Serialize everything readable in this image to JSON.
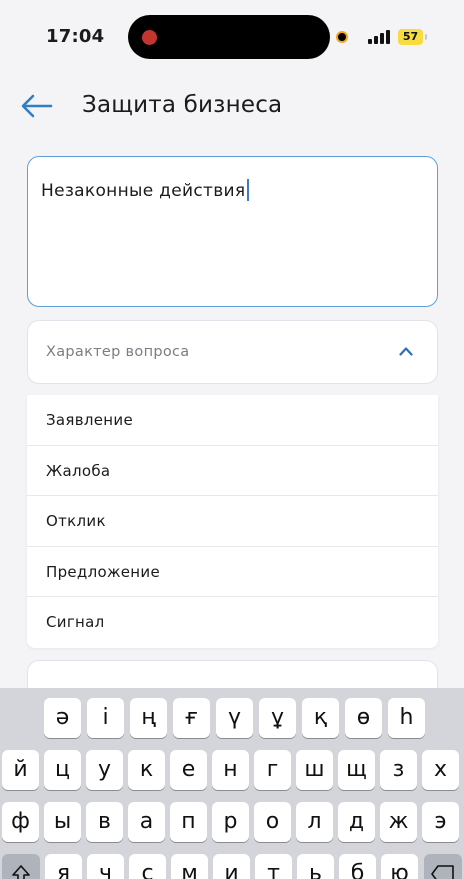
{
  "status_bar": {
    "time": "17:04",
    "battery": "57"
  },
  "header": {
    "title": "Защита бизнеса"
  },
  "form": {
    "textarea_value": "Незаконные действия",
    "question_type": {
      "placeholder": "Характер вопроса"
    },
    "options": [
      "Заявление",
      "Жалоба",
      "Отклик",
      "Предложение",
      "Сигнал"
    ]
  },
  "keyboard": {
    "row1": [
      "ә",
      "і",
      "ң",
      "ғ",
      "ү",
      "ұ",
      "қ",
      "ө",
      "һ"
    ],
    "row2": [
      "й",
      "ц",
      "у",
      "к",
      "е",
      "н",
      "г",
      "ш",
      "щ",
      "з",
      "х"
    ],
    "row3": [
      "ф",
      "ы",
      "в",
      "а",
      "п",
      "р",
      "о",
      "л",
      "д",
      "ж",
      "э"
    ],
    "row4": [
      "я",
      "ч",
      "с",
      "м",
      "и",
      "т",
      "ь",
      "б",
      "ю"
    ],
    "shift_icon": "shift-icon",
    "backspace_icon": "backspace-icon"
  }
}
